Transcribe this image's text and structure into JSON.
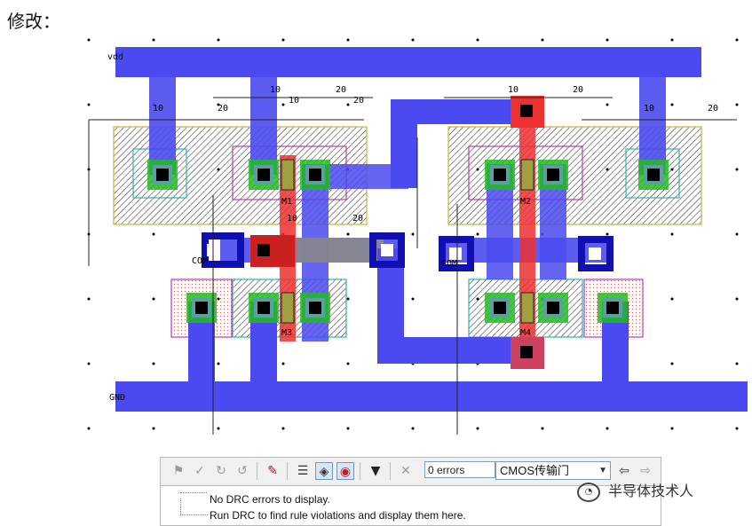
{
  "heading": "修改：",
  "layout": {
    "net_labels": {
      "vdd": "vdd",
      "gnd": "GND",
      "com_left": "COM",
      "com_right": "COM"
    },
    "transistor_labels": [
      "M1",
      "M2",
      "M3",
      "M4"
    ],
    "ruler_labels": [
      "10",
      "20"
    ],
    "colors": {
      "metal": "#4a4af0",
      "poly": "#ee3030",
      "active_green": "#22bb22",
      "contact": "#000000",
      "nwell_outline": "#d0c060",
      "select_outline": "#b040b0",
      "dark_blue": "#1010b0",
      "gray": "#8a8a8a"
    }
  },
  "toolbar": {
    "errors_field": "0 errors",
    "cell_select": "CMOS传输门",
    "icons": [
      "drc-run-icon",
      "drc-check-icon",
      "redo-icon",
      "undo-icon",
      "drc-settings-icon",
      "list-icon",
      "highlight-icon",
      "target-icon",
      "dropdown-arrow-icon",
      "clear-icon",
      "back-arrow-icon",
      "forward-arrow-icon"
    ]
  },
  "panel": {
    "line1": "No DRC errors to display.",
    "line2": "Run DRC to find rule violations and display them here."
  },
  "watermark": "半导体技术人"
}
